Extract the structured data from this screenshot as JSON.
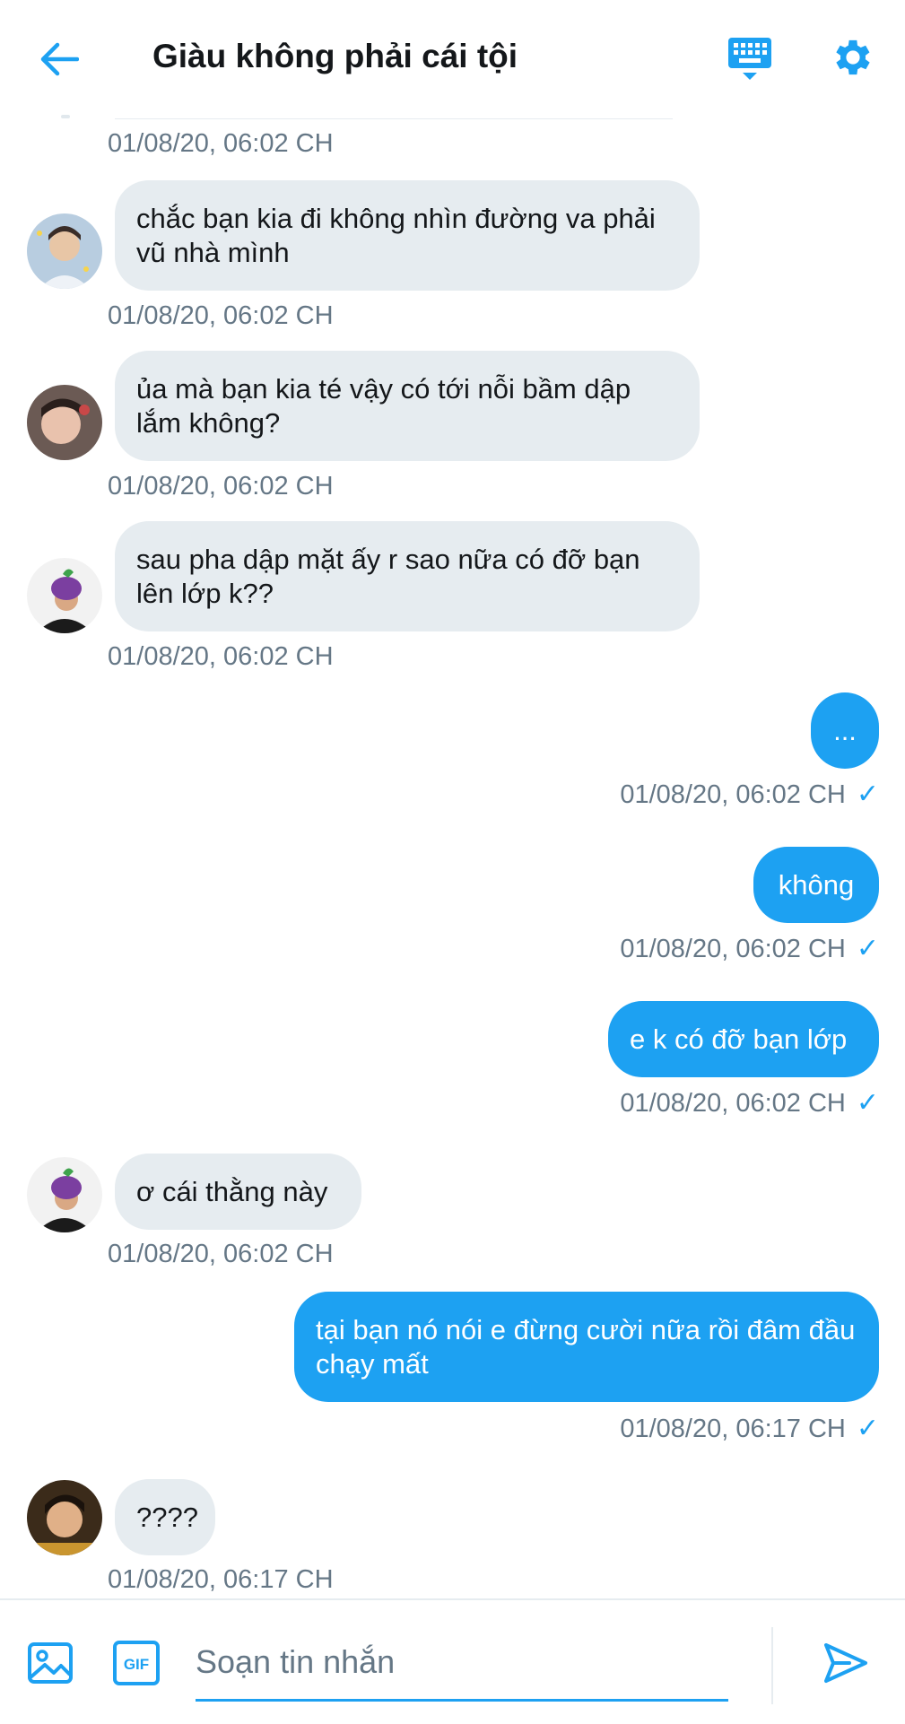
{
  "header": {
    "title": "Giàu không phải cái tội",
    "back_icon": "arrow-left-icon",
    "keyboard_icon": "keyboard-icon",
    "settings_icon": "gear-icon"
  },
  "colors": {
    "accent": "#1da1f2",
    "incoming_bubble": "#e6ecf0",
    "timestamp": "#657786"
  },
  "messages": [
    {
      "direction": "in",
      "text": "",
      "timestamp": "01/08/20, 06:02 CH"
    },
    {
      "direction": "in",
      "text": "chắc bạn kia đi không nhìn đường va phải vũ nhà mình",
      "timestamp": "01/08/20, 06:02 CH"
    },
    {
      "direction": "in",
      "text": "ủa mà bạn kia té vậy có tới nỗi bầm dập lắm không?",
      "timestamp": "01/08/20, 06:02 CH"
    },
    {
      "direction": "in",
      "text": "sau pha dập mặt ấy r sao nữa có đỡ bạn lên lớp k??",
      "timestamp": "01/08/20, 06:02 CH"
    },
    {
      "direction": "out",
      "text": "...",
      "timestamp": "01/08/20, 06:02 CH",
      "status": "✓"
    },
    {
      "direction": "out",
      "text": "không",
      "timestamp": "01/08/20, 06:02 CH",
      "status": "✓"
    },
    {
      "direction": "out",
      "text": "e k có đỡ bạn lớp",
      "timestamp": "01/08/20, 06:02 CH",
      "status": "✓"
    },
    {
      "direction": "in",
      "text": "ơ cái thằng này",
      "timestamp": "01/08/20, 06:02 CH"
    },
    {
      "direction": "out",
      "text": "tại bạn nó nói e đừng cười nữa rồi đâm đầu chạy mất",
      "timestamp": "01/08/20, 06:17 CH",
      "status": "✓"
    },
    {
      "direction": "in",
      "text": "????",
      "timestamp": "01/08/20, 06:17 CH"
    }
  ],
  "composer": {
    "placeholder": "Soạn tin nhắn",
    "image_icon": "image-icon",
    "gif_label": "GIF",
    "send_icon": "send-icon"
  }
}
